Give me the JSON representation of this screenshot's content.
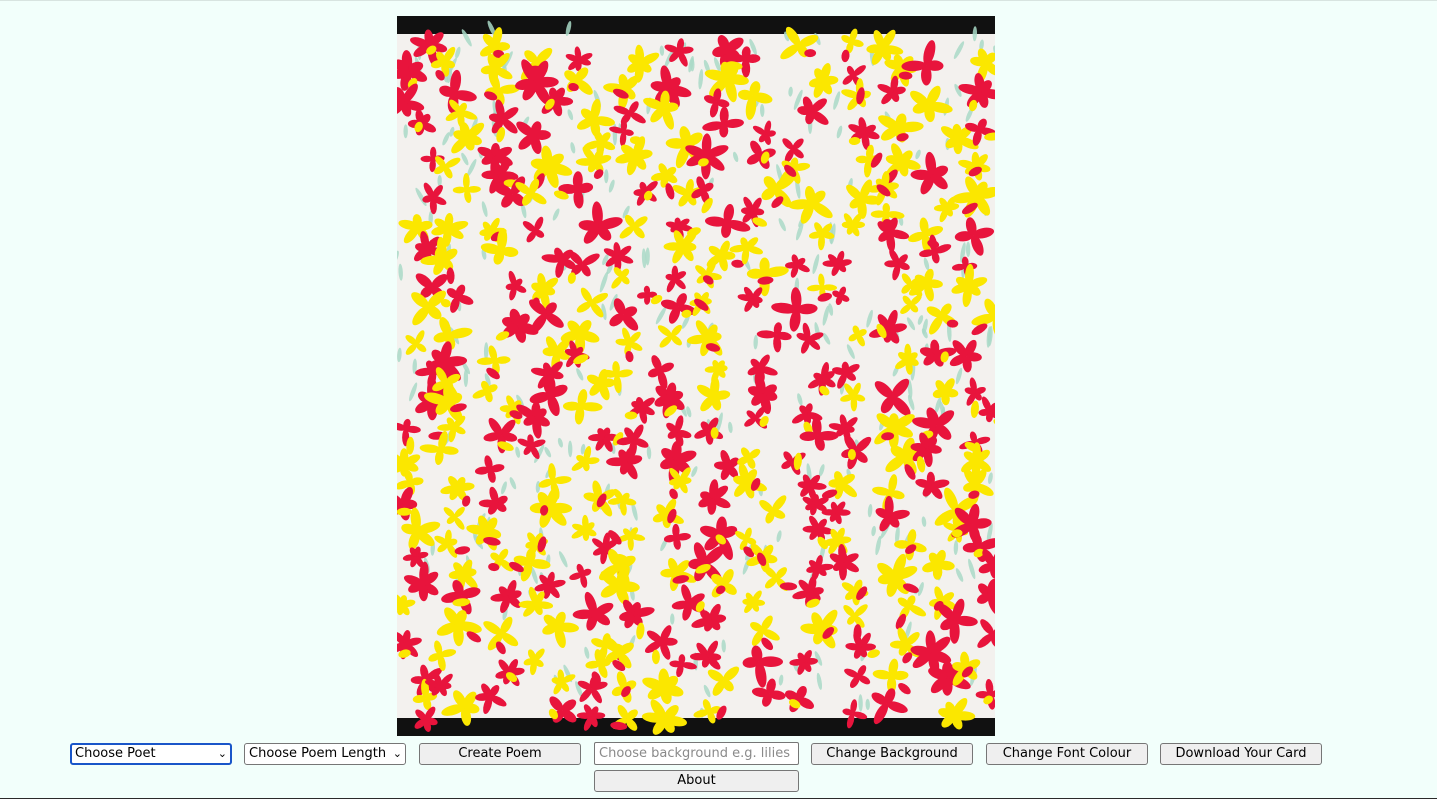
{
  "card": {
    "image_name": "floral-pattern-background",
    "colors": {
      "paper": "#f3f1ee",
      "red": "#e8143c",
      "yellow": "#fbe700",
      "leaf": "#a9d9c7",
      "border": "#111111"
    }
  },
  "controls": {
    "poet_select": "Choose Poet",
    "length_select": "Choose Poem Length",
    "create_poem": "Create Poem",
    "background_placeholder": "Choose background e.g. lilies",
    "change_background": "Change Background",
    "change_font_colour": "Change Font Colour",
    "download_card": "Download Your Card",
    "about": "About"
  }
}
